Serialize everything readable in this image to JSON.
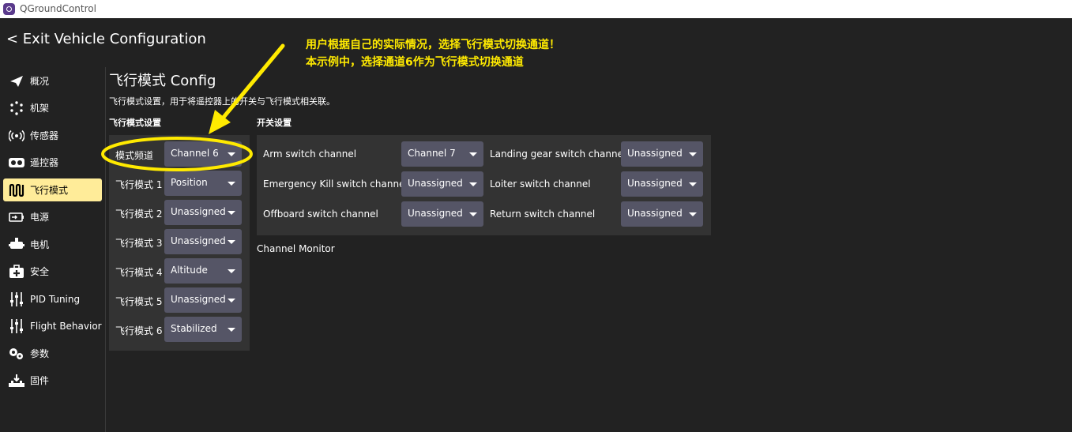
{
  "window": {
    "title": "QGroundControl"
  },
  "header": {
    "exit_label": "< Exit Vehicle Configuration"
  },
  "sidebar": {
    "items": [
      {
        "label": "概况",
        "icon": "paper-plane-icon"
      },
      {
        "label": "机架",
        "icon": "airframe-dots-icon"
      },
      {
        "label": "传感器",
        "icon": "sensors-icon"
      },
      {
        "label": "遥控器",
        "icon": "radio-controller-icon"
      },
      {
        "label": "飞行模式",
        "icon": "flight-modes-icon",
        "active": true
      },
      {
        "label": "电源",
        "icon": "battery-icon"
      },
      {
        "label": "电机",
        "icon": "motors-icon"
      },
      {
        "label": "安全",
        "icon": "safety-kit-icon"
      },
      {
        "label": "PID Tuning",
        "icon": "sliders-icon"
      },
      {
        "label": "Flight Behavior",
        "icon": "sliders-icon"
      },
      {
        "label": "参数",
        "icon": "gears-icon"
      },
      {
        "label": "固件",
        "icon": "firmware-icon"
      }
    ]
  },
  "page": {
    "title": "飞行模式 Config",
    "description": "飞行模式设置，用于将遥控器上的开关与飞行模式相关联。"
  },
  "flight_mode_settings": {
    "section_title": "飞行模式设置",
    "rows": [
      {
        "label": "模式频道",
        "value": "Channel 6"
      },
      {
        "label": "飞行模式 1",
        "value": "Position"
      },
      {
        "label": "飞行模式 2",
        "value": "Unassigned"
      },
      {
        "label": "飞行模式 3",
        "value": "Unassigned"
      },
      {
        "label": "飞行模式 4",
        "value": "Altitude"
      },
      {
        "label": "飞行模式 5",
        "value": "Unassigned"
      },
      {
        "label": "飞行模式 6",
        "value": "Stabilized"
      }
    ]
  },
  "switch_settings": {
    "section_title": "开关设置",
    "rows": [
      {
        "label": "Arm switch channel",
        "value": "Channel 7"
      },
      {
        "label": "Emergency Kill switch channel",
        "value": "Unassigned"
      },
      {
        "label": "Offboard switch channel",
        "value": "Unassigned"
      },
      {
        "label": "Landing gear switch channel",
        "value": "Unassigned"
      },
      {
        "label": "Loiter switch channel",
        "value": "Unassigned"
      },
      {
        "label": "Return switch channel",
        "value": "Unassigned"
      }
    ]
  },
  "channel_monitor": {
    "label": "Channel Monitor"
  },
  "annotation": {
    "line1": "用户根据自己的实际情况，选择飞行模式切换通道！",
    "line2": "本示例中，选择通道6作为飞行模式切换通道",
    "color": "#ffea00"
  },
  "colors": {
    "accent": "#ffec99",
    "background": "#222222",
    "panel": "#333333",
    "combo": "#555566"
  }
}
